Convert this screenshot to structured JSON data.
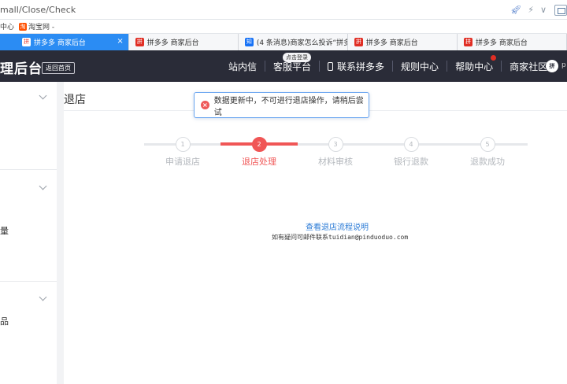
{
  "browser": {
    "address": "mall/Close/Check",
    "favorites": [
      {
        "label": "中心"
      },
      {
        "label": "淘宝网 -",
        "icon": "taobao-icon"
      }
    ],
    "tabs": [
      {
        "label": "拼多多 商家后台",
        "active": true,
        "icon": "pinduoduo-icon"
      },
      {
        "label": "拼多多 商家后台",
        "active": false,
        "icon": "pinduoduo-icon"
      },
      {
        "label": "(4 条消息)商家怎么投诉“拼多",
        "active": false,
        "icon": "zhihu-icon"
      },
      {
        "label": "拼多多 商家后台",
        "active": false,
        "icon": "pinduoduo-icon"
      },
      {
        "label": "拼多多 商家后台",
        "active": false,
        "icon": "pinduoduo-icon"
      }
    ],
    "tab_close": "×"
  },
  "header": {
    "brand": "理后台",
    "home_button": "返回首页",
    "login_bubble": "点击登录",
    "nav": {
      "inbox": "站内信",
      "service": "客服平台",
      "contact": "联系拼多多",
      "rules": "规则中心",
      "help": "帮助中心",
      "community": "商家社区"
    },
    "user_text": "p"
  },
  "sidebar": {
    "items": [
      {
        "label": "量"
      },
      {
        "label": "品"
      }
    ]
  },
  "main": {
    "title": "退店",
    "toast": {
      "message": "数据更新中，不可进行退店操作，请稍后尝试",
      "icon": "error-icon"
    },
    "steps": [
      {
        "number": "1",
        "label": "申请退店",
        "state": "done"
      },
      {
        "number": "2",
        "label": "退店处理",
        "state": "active"
      },
      {
        "number": "3",
        "label": "材料审核",
        "state": "pending"
      },
      {
        "number": "4",
        "label": "银行退款",
        "state": "pending"
      },
      {
        "number": "5",
        "label": "退款成功",
        "state": "pending"
      }
    ],
    "help_link": "查看退店流程说明",
    "help_email": "如有疑问可邮件联系tuidian@pinduoduo.com"
  },
  "colors": {
    "accent_red": "#f05656",
    "header_bg": "#2a2c38",
    "tab_active": "#2b8cf3",
    "link_blue": "#2b7bd6"
  }
}
